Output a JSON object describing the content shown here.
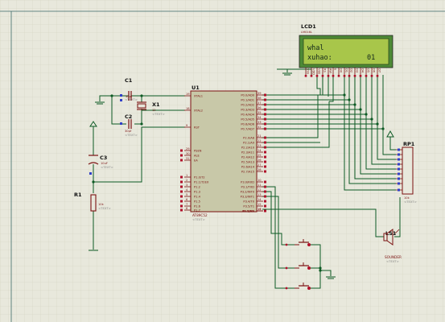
{
  "lcd": {
    "ref": "LCD1",
    "model": "LM016L",
    "line1": "whal",
    "line2": "xuhao:",
    "line2_value": "01",
    "pins": [
      "VSS",
      "VDD",
      "VEE",
      "RS",
      "RW",
      "E",
      "D0",
      "D1",
      "D2",
      "D3",
      "D4",
      "D5",
      "D6",
      "D7"
    ]
  },
  "u1": {
    "ref": "U1",
    "model": "AT89C52",
    "text": "<TEXT>",
    "left_pins": [
      "XTAL1",
      "XTAL2",
      "RST",
      "PSEN",
      "ALE",
      "EA",
      "P1.0/T2",
      "P1.1/T2EX",
      "P1.2",
      "P1.3",
      "P1.4",
      "P1.5",
      "P1.6",
      "P1.7"
    ],
    "left_nums": [
      "19",
      "18",
      "9",
      "29",
      "30",
      "31",
      "1",
      "2",
      "3",
      "4",
      "5",
      "6",
      "7",
      "8"
    ],
    "right_pins": [
      "P0.0/AD0",
      "P0.1/AD1",
      "P0.2/AD2",
      "P0.3/AD3",
      "P0.4/AD4",
      "P0.5/AD5",
      "P0.6/AD6",
      "P0.7/AD7",
      "P2.0/A8",
      "P2.1/A9",
      "P2.2/A10",
      "P2.3/A11",
      "P2.4/A12",
      "P2.5/A13",
      "P2.6/A14",
      "P2.7/A15",
      "P3.0/RXD",
      "P3.1/TXD",
      "P3.2/INT0",
      "P3.3/INT1",
      "P3.4/T0",
      "P3.5/T1",
      "P3.6/WR",
      "P3.7/RD"
    ],
    "right_nums": [
      "39",
      "38",
      "37",
      "36",
      "35",
      "34",
      "33",
      "32",
      "21",
      "22",
      "23",
      "24",
      "25",
      "26",
      "27",
      "28",
      "10",
      "11",
      "12",
      "13",
      "14",
      "15",
      "16",
      "17"
    ]
  },
  "c1": {
    "ref": "C1",
    "value": "30pf",
    "text": "<TEXT>"
  },
  "c2": {
    "ref": "C2",
    "value": "30pf",
    "text": "<TEXT>"
  },
  "c3": {
    "ref": "C3",
    "value": "10uF",
    "text": "<TEXT>"
  },
  "x1": {
    "ref": "X1",
    "value": "12",
    "text": "<TEXT>"
  },
  "r1": {
    "ref": "R1",
    "value": "10k",
    "text": "<TEXT>"
  },
  "rp1": {
    "ref": "RP1",
    "value": "10k",
    "text": "<TEXT>"
  },
  "ls1": {
    "ref": "LS1",
    "value": "SOUNDER",
    "text": "<TEXT>"
  },
  "colors": {
    "background": "#e8e8dc",
    "grid": "#d4d4c4",
    "wire": "#0d5a24",
    "component": "#7a1010",
    "chip_fill": "#c8c8a8",
    "lcd_screen": "#a8c64a",
    "lcd_body": "#4d8a36"
  }
}
